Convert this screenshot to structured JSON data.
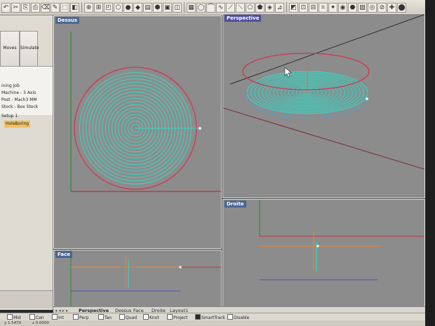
{
  "viewports": {
    "dessus": {
      "title": "Dessus"
    },
    "perspective": {
      "title": "Perspective"
    },
    "droite": {
      "title": "Droite"
    },
    "face": {
      "title": "Face"
    }
  },
  "left_panel": {
    "move_label": "Moves",
    "simulate_label": "Simulate",
    "tree": [
      "ining Job",
      "Machine - 3 Axis",
      "Post - Mach3 MM",
      "Stock - Box Stock",
      "Setup 1",
      "HoleBoring"
    ]
  },
  "tabs": [
    "Perspective",
    "Dessus",
    "Face",
    "Droite",
    "Layout1"
  ],
  "snaps": [
    "Mid",
    "Cen",
    "Int",
    "Perp",
    "Tan",
    "Quad",
    "Knot",
    "Project",
    "SmartTrack",
    "Disable"
  ],
  "snaps_checked": [
    "SmartTrack"
  ],
  "status": {
    "coord_x": "y 1.5470",
    "coord_z": "z 0.0000"
  },
  "colors": {
    "toolpath": "#38d6c2",
    "circle_red": "#d0364f",
    "axis_green": "#2e8b2e",
    "axis_red": "#b8333a",
    "axis_blue": "#4b55b8",
    "orange_guide": "#e0823a",
    "viewport_bg": "#8c8c8c"
  }
}
